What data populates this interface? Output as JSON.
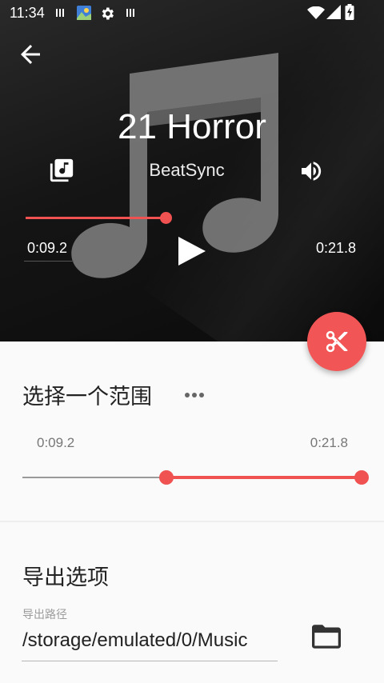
{
  "status_bar": {
    "time": "11:34",
    "icons": [
      "sim-icon",
      "photo-notification-icon",
      "settings-icon",
      "sim-icon",
      "wifi-icon",
      "signal-icon",
      "battery-charging-icon"
    ]
  },
  "player": {
    "title": "21 Horror",
    "artist": "BeatSync",
    "current_time": "0:09.2",
    "total_time": "0:21.8",
    "progress": 0.42,
    "icons": {
      "back": "arrow-back-icon",
      "library": "music-library-icon",
      "volume": "volume-icon",
      "play": "play-icon",
      "artwork": "music-note-icon",
      "cut": "scissors-icon"
    }
  },
  "range": {
    "title": "选择一个范围",
    "start": "0:09.2",
    "end": "0:21.8",
    "start_fraction": 0.42,
    "end_fraction": 1.0
  },
  "export": {
    "title": "导出选项",
    "path_label": "导出路径",
    "path_value": "/storage/emulated/0/Music",
    "folder_icon": "folder-icon"
  },
  "colors": {
    "accent": "#f05151",
    "header_bg": "#141414",
    "card_bg": "#fafafa"
  }
}
